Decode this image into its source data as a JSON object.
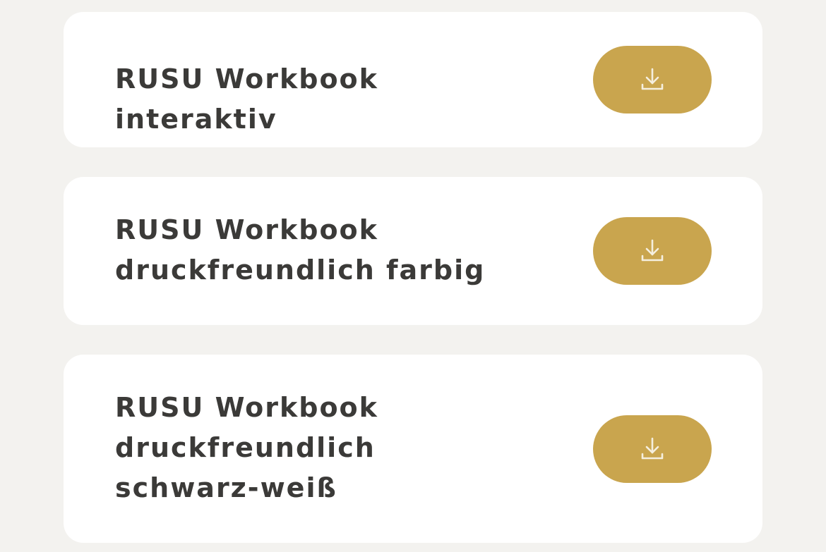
{
  "colors": {
    "background": "#f3f2ef",
    "card": "#ffffff",
    "accent": "#c9a54e",
    "text": "#3b3a38",
    "icon": "#f5efdf"
  },
  "downloads": [
    {
      "title": "RUSU Workbook interaktiv",
      "icon": "download-icon"
    },
    {
      "title": "RUSU Workbook druckfreundlich farbig",
      "icon": "download-icon"
    },
    {
      "title": "RUSU Workbook druckfreundlich schwarz-weiß",
      "icon": "download-icon"
    }
  ]
}
